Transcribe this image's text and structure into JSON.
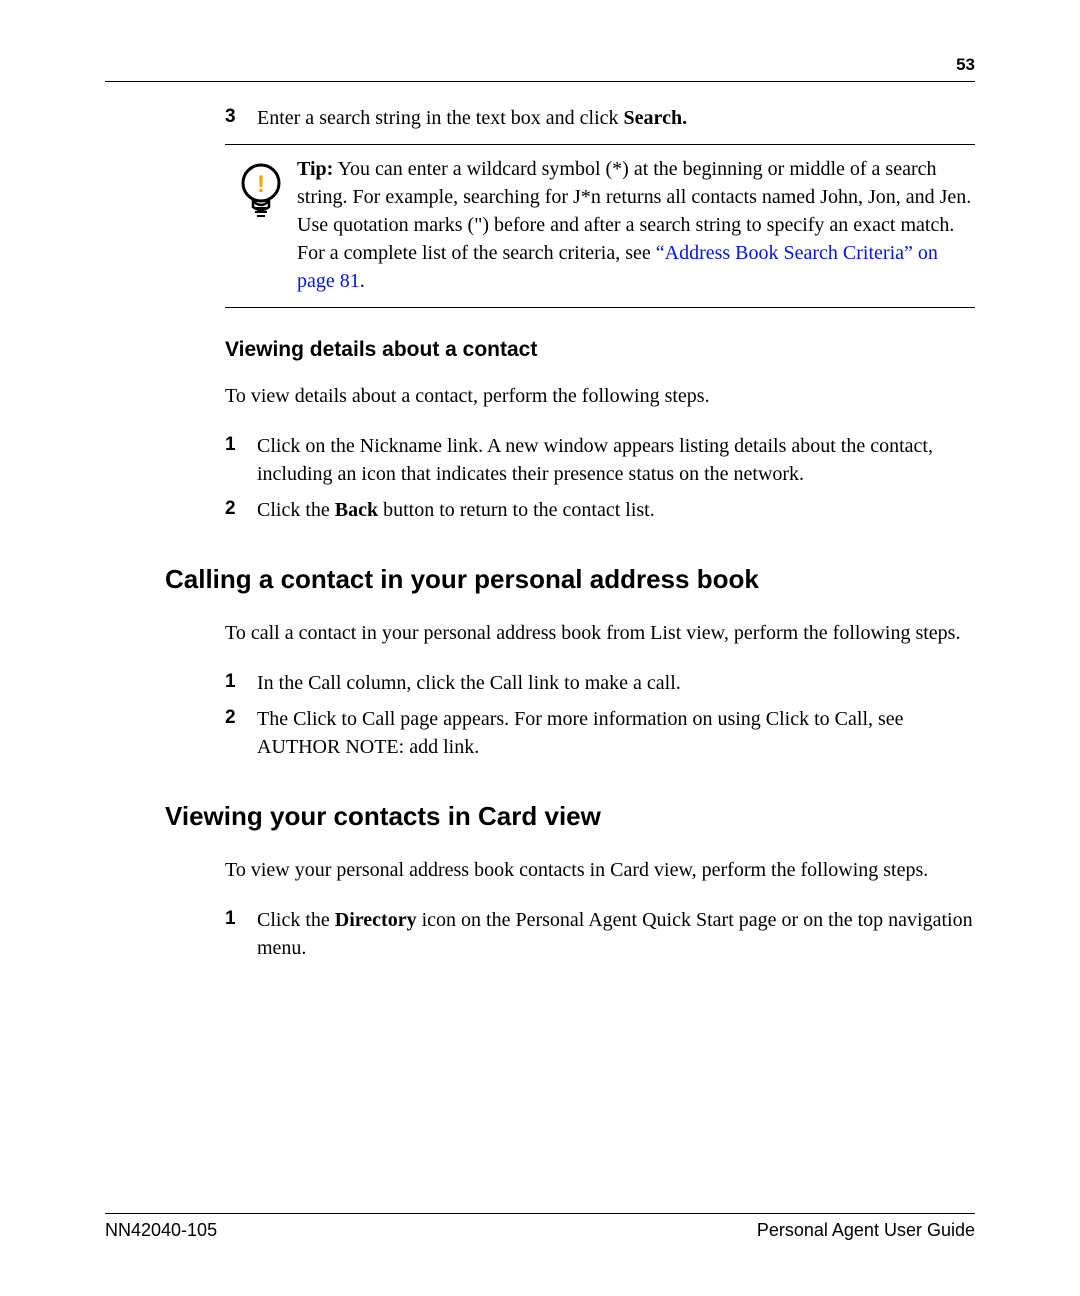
{
  "pageNumber": "53",
  "step3": {
    "num": "3",
    "prefix": "Enter a search string in the text box and click ",
    "bold": "Search."
  },
  "tip": {
    "label": "Tip:",
    "body_before_link": " You can enter a wildcard symbol (*) at the beginning or middle of a search string. For example, searching for J*n returns all contacts named John, Jon, and Jen. Use quotation marks (\") before and after a search string to specify an exact match. For a complete list of the search criteria, see ",
    "link": "“Address Book Search Criteria” on page 81",
    "after_link": "."
  },
  "section_viewing_details": {
    "heading": "Viewing details about a contact",
    "intro": "To view details about a contact, perform the following steps.",
    "steps": [
      {
        "num": "1",
        "text": "Click on the Nickname link. A new window appears listing details about the contact, including an icon that indicates their presence status on the network."
      },
      {
        "num": "2",
        "prefix": "Click the ",
        "bold": "Back",
        "suffix": " button to return to the contact list."
      }
    ]
  },
  "section_calling": {
    "heading": "Calling a contact in your personal address book",
    "intro": "To call a contact in your personal address book from List view, perform the following steps.",
    "steps": [
      {
        "num": "1",
        "text": "In the Call column, click the Call link to make a call."
      },
      {
        "num": "2",
        "text": "The Click to Call page appears.  For more information on using Click to Call, see AUTHOR NOTE:  add link."
      }
    ]
  },
  "section_cardview": {
    "heading": "Viewing your contacts in Card view",
    "intro": "To view your personal address book contacts in Card view, perform the following steps.",
    "steps": [
      {
        "num": "1",
        "prefix": "Click the ",
        "bold": "Directory",
        "suffix": " icon on the Personal Agent Quick Start page or on the top navigation menu."
      }
    ]
  },
  "footer": {
    "left": "NN42040-105",
    "right": "Personal Agent User Guide"
  }
}
